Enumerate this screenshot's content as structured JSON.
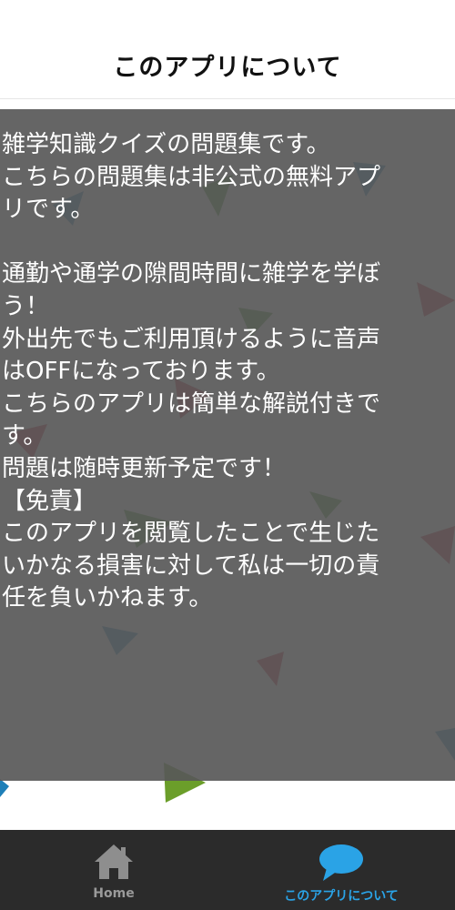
{
  "header": {
    "title": "このアプリについて"
  },
  "description": {
    "lines": [
      "雑学知識クイズの問題集です。",
      "こちらの問題集は非公式の無料アプ",
      "リです。",
      "",
      "通勤や通学の隙間時間に雑学を学ぼ",
      "う！",
      "外出先でもご利用頂けるように音声",
      "はOFFになっております。",
      "こちらのアプリは簡単な解説付きで",
      "す。",
      "問題は随時更新予定です！",
      "【免責】",
      "このアプリを閲覧したことで生じた",
      "いかなる損害に対して私は一切の責",
      "任を負いかねます。"
    ]
  },
  "tabs": [
    {
      "label": "Home",
      "icon": "home-icon",
      "active": false
    },
    {
      "label": "このアプリについて",
      "icon": "speech-bubble-icon",
      "active": true
    }
  ],
  "colors": {
    "active_tab": "#2aa3e6",
    "inactive_tab": "#9a9a9a",
    "tabbar_bg": "#2b2b2b",
    "confetti": [
      "#1e7fb8",
      "#3f8f1e",
      "#c0182a",
      "#6b9e2a"
    ]
  }
}
